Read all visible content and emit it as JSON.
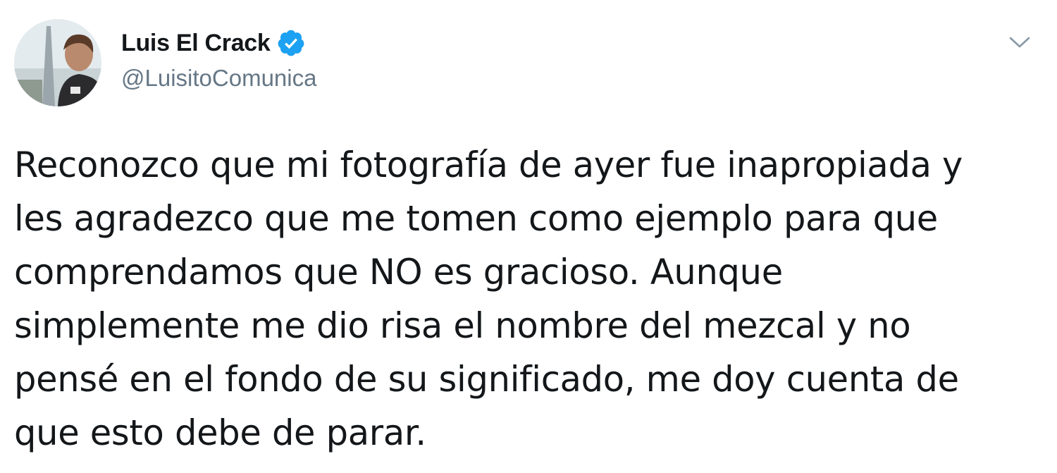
{
  "tweet": {
    "author": {
      "display_name": "Luis El Crack",
      "handle": "@LuisitoComunica",
      "verified": true
    },
    "text": "Reconozco que mi fotografía de ayer fue inapropiada y\nles agradezco que me tomen como ejemplo para que\ncomprendamos que NO es gracioso. Aunque\nsimplemente me dio risa el nombre del mezcal y no\npensé en el fondo de su significado, me doy cuenta de\nque esto debe de parar.",
    "icons": {
      "verified": "verified-badge-icon",
      "menu": "chevron-down-icon"
    },
    "colors": {
      "verified_blue": "#1da1f2",
      "text_primary": "#14171a",
      "text_secondary": "#657786"
    }
  }
}
